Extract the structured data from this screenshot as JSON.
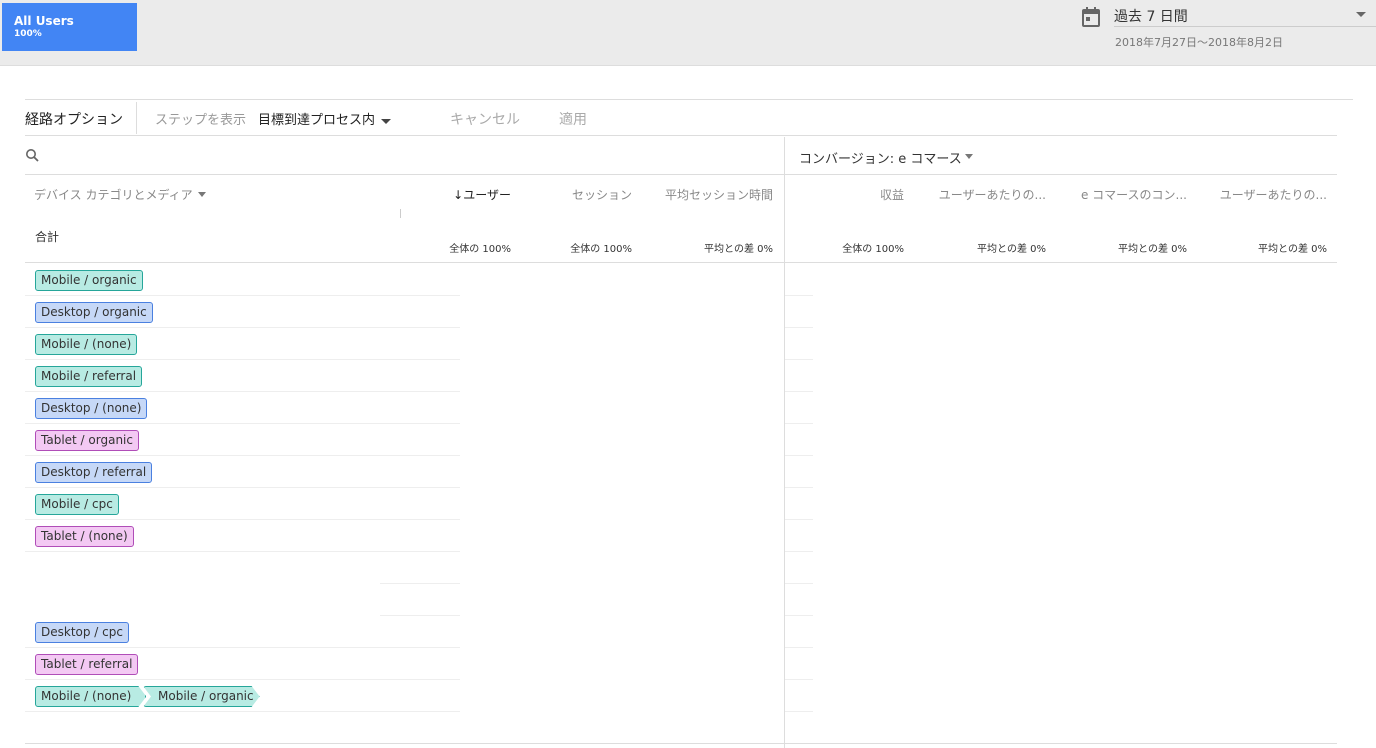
{
  "segment": {
    "name": "All Users",
    "percent": "100%",
    "color": "#4285f4"
  },
  "date_range": {
    "label": "過去 7 日間",
    "range": "2018年7月27日～2018年8月2日",
    "icon": "calendar-icon"
  },
  "options": {
    "title": "経路オプション",
    "steps_label": "ステップを表示",
    "steps_value": "目標到達プロセス内",
    "cancel": "キャンセル",
    "apply": "適用"
  },
  "search": {
    "icon": "search-icon",
    "placeholder": ""
  },
  "conversion": {
    "label": "コンバージョン: e コマース"
  },
  "table": {
    "dimension_header": "デバイス カテゴリとメディア",
    "total_label": "合計",
    "metrics_left": [
      {
        "label": "ユーザー",
        "sub": "全体の 100%",
        "sorted": true
      },
      {
        "label": "セッション",
        "sub": "全体の 100%"
      },
      {
        "label": "平均セッション時間",
        "sub": "平均との差 0%"
      }
    ],
    "metrics_right": [
      {
        "label": "収益",
        "sub": "全体の 100%"
      },
      {
        "label": "ユーザーあたりの...",
        "sub": "平均との差 0%"
      },
      {
        "label": "e コマースのコン...",
        "sub": "平均との差 0%"
      },
      {
        "label": "ユーザーあたりの...",
        "sub": "平均との差 0%"
      }
    ],
    "sort_arrow": "↓"
  },
  "rows": [
    {
      "steps": [
        {
          "label": "Mobile / organic",
          "type": "mobile"
        }
      ]
    },
    {
      "steps": [
        {
          "label": "Desktop / organic",
          "type": "desktop"
        }
      ]
    },
    {
      "steps": [
        {
          "label": "Mobile / (none)",
          "type": "mobile"
        }
      ]
    },
    {
      "steps": [
        {
          "label": "Mobile / referral",
          "type": "mobile"
        }
      ]
    },
    {
      "steps": [
        {
          "label": "Desktop / (none)",
          "type": "desktop"
        }
      ]
    },
    {
      "steps": [
        {
          "label": "Tablet / organic",
          "type": "tablet"
        }
      ]
    },
    {
      "steps": [
        {
          "label": "Desktop / referral",
          "type": "desktop"
        }
      ]
    },
    {
      "steps": [
        {
          "label": "Mobile / cpc",
          "type": "mobile"
        }
      ]
    },
    {
      "steps": [
        {
          "label": "Tablet / (none)",
          "type": "tablet"
        }
      ]
    },
    {
      "steps": []
    },
    {
      "steps": []
    },
    {
      "steps": [
        {
          "label": "Desktop / cpc",
          "type": "desktop"
        }
      ]
    },
    {
      "steps": [
        {
          "label": "Tablet / referral",
          "type": "tablet"
        }
      ]
    },
    {
      "steps": [
        {
          "label": "Mobile / (none)",
          "type": "mobile"
        },
        {
          "label": "Mobile / organic",
          "type": "mobile"
        }
      ]
    },
    {
      "steps": []
    }
  ]
}
